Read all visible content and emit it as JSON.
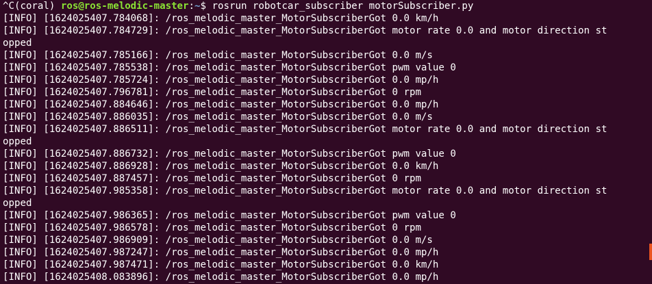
{
  "terminal": {
    "prompt": {
      "prefix": "^C(coral) ",
      "user_host": "ros@ros-melodic-master",
      "separator": ":",
      "path": "~",
      "symbol": "$ ",
      "command": "rosrun robotcar_subscriber motorSubscriber.py"
    },
    "lines": [
      "[INFO] [1624025407.784068]: /ros_melodic_master_MotorSubscriberGot 0.0 km/h",
      "[INFO] [1624025407.784729]: /ros_melodic_master_MotorSubscriberGot motor rate 0.0 and motor direction st",
      "opped",
      "[INFO] [1624025407.785166]: /ros_melodic_master_MotorSubscriberGot 0.0 m/s",
      "[INFO] [1624025407.785538]: /ros_melodic_master_MotorSubscriberGot pwm value 0",
      "[INFO] [1624025407.785724]: /ros_melodic_master_MotorSubscriberGot 0.0 mp/h",
      "[INFO] [1624025407.796781]: /ros_melodic_master_MotorSubscriberGot 0 rpm",
      "[INFO] [1624025407.884646]: /ros_melodic_master_MotorSubscriberGot 0.0 mp/h",
      "[INFO] [1624025407.886035]: /ros_melodic_master_MotorSubscriberGot 0.0 m/s",
      "[INFO] [1624025407.886511]: /ros_melodic_master_MotorSubscriberGot motor rate 0.0 and motor direction st",
      "opped",
      "[INFO] [1624025407.886732]: /ros_melodic_master_MotorSubscriberGot pwm value 0",
      "[INFO] [1624025407.886928]: /ros_melodic_master_MotorSubscriberGot 0.0 km/h",
      "[INFO] [1624025407.887457]: /ros_melodic_master_MotorSubscriberGot 0 rpm",
      "[INFO] [1624025407.985358]: /ros_melodic_master_MotorSubscriberGot motor rate 0.0 and motor direction st",
      "opped",
      "[INFO] [1624025407.986365]: /ros_melodic_master_MotorSubscriberGot pwm value 0",
      "[INFO] [1624025407.986578]: /ros_melodic_master_MotorSubscriberGot 0 rpm",
      "[INFO] [1624025407.986909]: /ros_melodic_master_MotorSubscriberGot 0.0 m/s",
      "[INFO] [1624025407.987247]: /ros_melodic_master_MotorSubscriberGot 0.0 mp/h",
      "[INFO] [1624025407.987471]: /ros_melodic_master_MotorSubscriberGot 0.0 km/h",
      "[INFO] [1624025408.083896]: /ros_melodic_master_MotorSubscriberGot 0.0 mp/h"
    ]
  },
  "colors": {
    "background": "#300a24",
    "text": "#ffffff",
    "prompt_user": "#8ae234",
    "prompt_path": "#729fcf",
    "scroll_marker": "#e95420"
  }
}
